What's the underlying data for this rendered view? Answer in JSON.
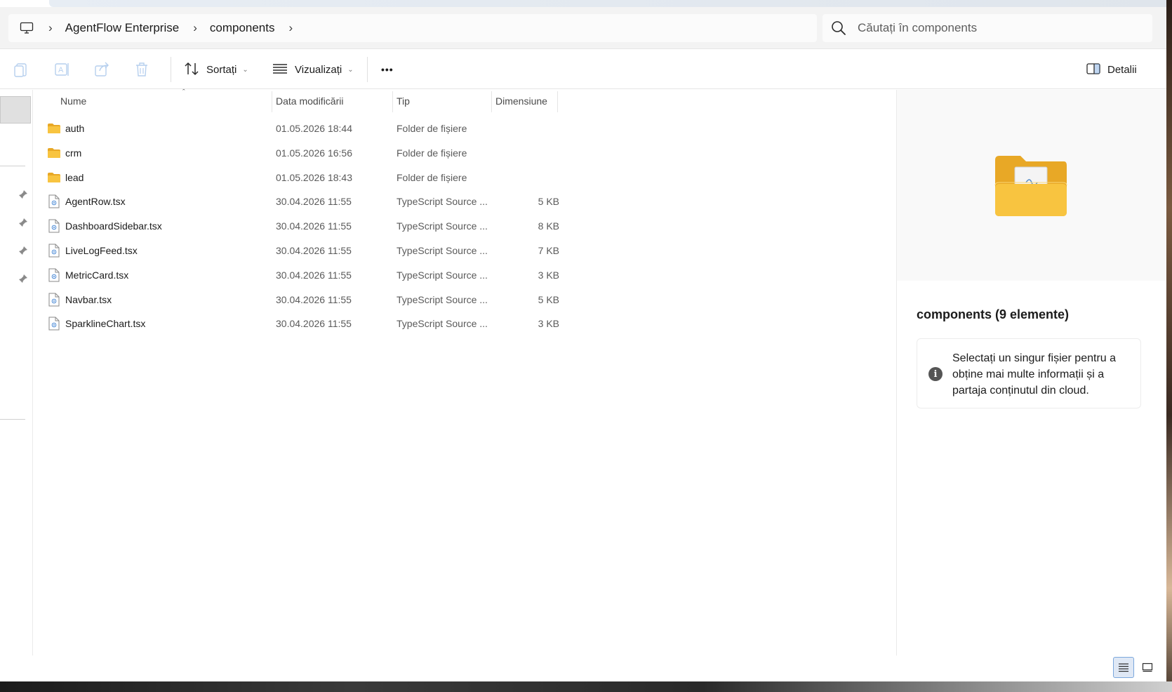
{
  "addressbar": {
    "breadcrumb": [
      "AgentFlow Enterprise",
      "components"
    ],
    "separator": "›",
    "search_placeholder": "Căutați în components"
  },
  "toolbar": {
    "sort_label": "Sortați",
    "view_label": "Vizualizați",
    "more_label": "•••",
    "details_label": "Detalii",
    "icons": [
      "copy-icon",
      "rename-icon",
      "share-icon",
      "delete-icon",
      "sort-icon",
      "view-icon",
      "more-icon",
      "details-pane-icon"
    ]
  },
  "columns": {
    "name": "Nume",
    "date": "Data modificării",
    "type": "Tip",
    "size": "Dimensiune"
  },
  "files": [
    {
      "name": "auth",
      "date": "01.05.2026 18:44",
      "type": "Folder de fișiere",
      "size": "",
      "icon": "folder-icon"
    },
    {
      "name": "crm",
      "date": "01.05.2026 16:56",
      "type": "Folder de fișiere",
      "size": "",
      "icon": "folder-icon"
    },
    {
      "name": "lead",
      "date": "01.05.2026 18:43",
      "type": "Folder de fișiere",
      "size": "",
      "icon": "folder-icon"
    },
    {
      "name": "AgentRow.tsx",
      "date": "30.04.2026 11:55",
      "type": "TypeScript Source ...",
      "size": "5 KB",
      "icon": "file-icon"
    },
    {
      "name": "DashboardSidebar.tsx",
      "date": "30.04.2026 11:55",
      "type": "TypeScript Source ...",
      "size": "8 KB",
      "icon": "file-icon"
    },
    {
      "name": "LiveLogFeed.tsx",
      "date": "30.04.2026 11:55",
      "type": "TypeScript Source ...",
      "size": "7 KB",
      "icon": "file-icon"
    },
    {
      "name": "MetricCard.tsx",
      "date": "30.04.2026 11:55",
      "type": "TypeScript Source ...",
      "size": "3 KB",
      "icon": "file-icon"
    },
    {
      "name": "Navbar.tsx",
      "date": "30.04.2026 11:55",
      "type": "TypeScript Source ...",
      "size": "5 KB",
      "icon": "file-icon"
    },
    {
      "name": "SparklineChart.tsx",
      "date": "30.04.2026 11:55",
      "type": "TypeScript Source ...",
      "size": "3 KB",
      "icon": "file-icon"
    }
  ],
  "details": {
    "title": "components (9 elemente)",
    "info": "Selectați un singur fișier pentru a obține mai multe informații și a partaja conținutul din cloud."
  },
  "colors": {
    "folder_yellow": "#f8c440",
    "selected_view": "#dfe8f5",
    "accent": "#7aa7dc"
  }
}
